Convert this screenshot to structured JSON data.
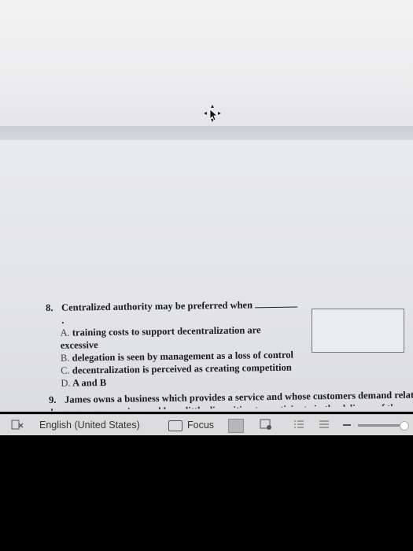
{
  "question8": {
    "number": "8.",
    "stem": "Centralized authority may be preferred when",
    "stem_end": ".",
    "options": [
      {
        "letter": "A.",
        "text": "training costs to support decentralization are excessive"
      },
      {
        "letter": "B.",
        "text": "delegation is seen by management as a loss of control"
      },
      {
        "letter": "C.",
        "text": "decentralization is perceived as creating competition"
      },
      {
        "letter": "D.",
        "text": "A and B"
      }
    ]
  },
  "question9": {
    "number": "9.",
    "stem": "James owns a business which provides a service and whose customers demand relatively",
    "cut_line": "homogeneous services and have little disposition to participate in the delivery of these"
  },
  "statusbar": {
    "language": "English (United States)",
    "focus_label": "Focus"
  },
  "colors": {
    "statusbar_bg": "#dcdcde",
    "page_bg": "#e9eaed",
    "outer_bg": "#000000"
  }
}
